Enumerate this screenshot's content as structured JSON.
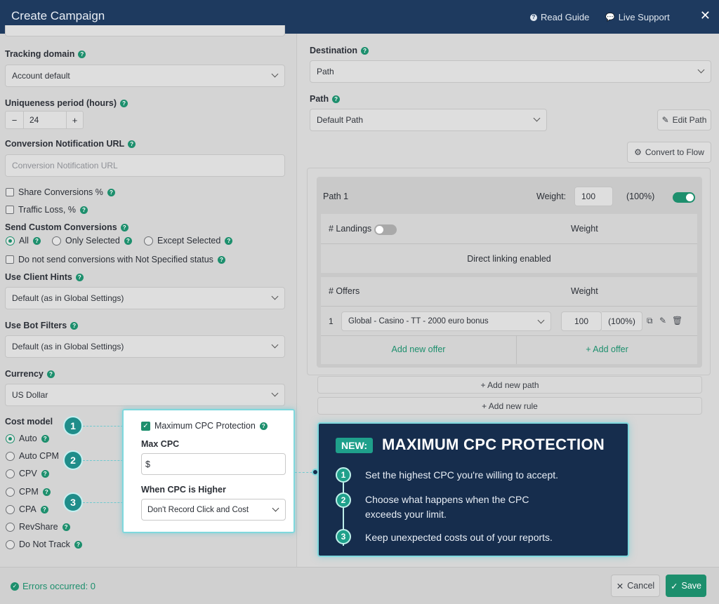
{
  "header": {
    "title": "Create Campaign",
    "read_guide": "Read Guide",
    "live_support": "Live Support",
    "close": "✕"
  },
  "left": {
    "tracking_domain": {
      "label": "Tracking domain",
      "value": "Account default"
    },
    "uniqueness": {
      "label": "Uniqueness period (hours)",
      "value": "24",
      "minus": "−",
      "plus": "+"
    },
    "conversion_url": {
      "label": "Conversion Notification URL",
      "placeholder": "Conversion Notification URL"
    },
    "share_conversions": "Share Conversions %",
    "traffic_loss": "Traffic Loss, %",
    "send_custom": {
      "label": "Send Custom Conversions",
      "options": [
        "All",
        "Only Selected",
        "Except Selected"
      ],
      "selected": "All"
    },
    "not_specified": "Do not send conversions with Not Specified status",
    "client_hints": {
      "label": "Use Client Hints",
      "value": "Default (as in Global Settings)"
    },
    "bot_filters": {
      "label": "Use Bot Filters",
      "value": "Default (as in Global Settings)"
    },
    "currency": {
      "label": "Currency",
      "value": "US Dollar"
    },
    "cost_model": {
      "label": "Cost model",
      "options": [
        "Auto",
        "Auto CPM",
        "CPV",
        "CPM",
        "CPA",
        "RevShare",
        "Do Not Track"
      ],
      "selected": "Auto"
    }
  },
  "right": {
    "destination": {
      "label": "Destination",
      "value": "Path"
    },
    "path": {
      "label": "Path",
      "value": "Default Path"
    },
    "edit_path": "Edit Path",
    "convert_flow": "Convert to Flow",
    "path1": {
      "name": "Path 1",
      "weight_label": "Weight:",
      "weight": "100",
      "percent": "(100%)",
      "enabled": true
    },
    "landings": {
      "header": "# Landings",
      "weight_header": "Weight",
      "direct": "Direct linking enabled"
    },
    "offers": {
      "header": "# Offers",
      "weight_header": "Weight",
      "rows": [
        {
          "index": "1",
          "name": "Global - Casino - TT - 2000 euro bonus",
          "weight": "100",
          "percent": "(100%)"
        }
      ],
      "add_new_offer": "Add new offer",
      "add_offer": "+ Add offer"
    },
    "add_path": "+ Add new path",
    "add_rule": "+ Add new rule"
  },
  "popup": {
    "checkbox_label": "Maximum CPC Protection",
    "checked": true,
    "max_cpc_label": "Max CPC",
    "max_cpc_value": "$",
    "higher_label": "When CPC is Higher",
    "higher_value": "Don't Record Click and Cost",
    "badges": [
      "1",
      "2",
      "3"
    ]
  },
  "callout": {
    "badge": "NEW:",
    "title": "MAXIMUM CPC PROTECTION",
    "steps": [
      {
        "n": "1",
        "text": "Set the highest CPC you're willing to accept."
      },
      {
        "n": "2",
        "text": "Choose what happens when the CPC exceeds your limit."
      },
      {
        "n": "3",
        "text": "Keep unexpected costs out of your reports."
      }
    ]
  },
  "footer": {
    "status": "Errors occurred: 0",
    "cancel": "Cancel",
    "save": "Save"
  },
  "colors": {
    "accent": "#1d8f6d",
    "header": "#1e3a5f",
    "callout": "#162d4d",
    "highlight": "#7fd8dd"
  }
}
